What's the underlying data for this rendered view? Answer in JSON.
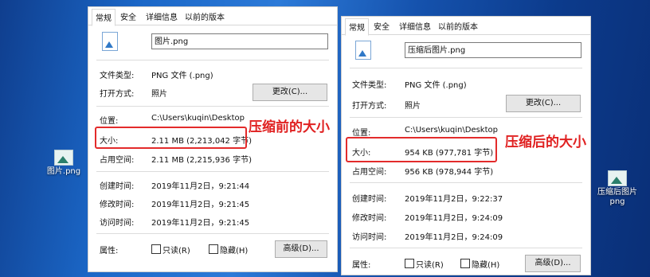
{
  "left_window": {
    "tabs": [
      "常规",
      "安全",
      "详细信息",
      "以前的版本"
    ],
    "filename": "图片.png",
    "file_type_label": "文件类型:",
    "file_type_value": "PNG 文件 (.png)",
    "open_with_label": "打开方式:",
    "open_with_value": "照片",
    "change_button": "更改(C)...",
    "location_label": "位置:",
    "location_value": "C:\\Users\\kuqin\\Desktop",
    "size_label": "大小:",
    "size_value": "2.11 MB (2,213,042 字节)",
    "size_on_disk_label": "占用空间:",
    "size_on_disk_value": "2.11 MB (2,215,936 字节)",
    "created_label": "创建时间:",
    "created_value": "2019年11月2日，9:21:44",
    "modified_label": "修改时间:",
    "modified_value": "2019年11月2日，9:21:45",
    "accessed_label": "访问时间:",
    "accessed_value": "2019年11月2日，9:21:45",
    "attributes_label": "属性:",
    "readonly_label": "只读(R)",
    "hidden_label": "隐藏(H)",
    "advanced_button": "高级(D)...",
    "annotation": "压缩前的大小"
  },
  "right_window": {
    "tabs": [
      "常规",
      "安全",
      "详细信息",
      "以前的版本"
    ],
    "filename": "压缩后图片.png",
    "file_type_label": "文件类型:",
    "file_type_value": "PNG 文件 (.png)",
    "open_with_label": "打开方式:",
    "open_with_value": "照片",
    "change_button": "更改(C)...",
    "location_label": "位置:",
    "location_value": "C:\\Users\\kuqin\\Desktop",
    "size_label": "大小:",
    "size_value": "954 KB (977,781 字节)",
    "size_on_disk_label": "占用空间:",
    "size_on_disk_value": "956 KB (978,944 字节)",
    "created_label": "创建时间:",
    "created_value": "2019年11月2日，9:22:37",
    "modified_label": "修改时间:",
    "modified_value": "2019年11月2日，9:24:09",
    "accessed_label": "访问时间:",
    "accessed_value": "2019年11月2日，9:24:09",
    "attributes_label": "属性:",
    "readonly_label": "只读(R)",
    "hidden_label": "隐藏(H)",
    "advanced_button": "高级(D)...",
    "annotation": "压缩后的大小"
  },
  "desktop_icons": {
    "left": "图片.png",
    "right_line1": "压缩后图片",
    "right_line2": "png"
  },
  "colors": {
    "highlight_red": "#e32b2b",
    "annotation_red": "#e02121"
  }
}
